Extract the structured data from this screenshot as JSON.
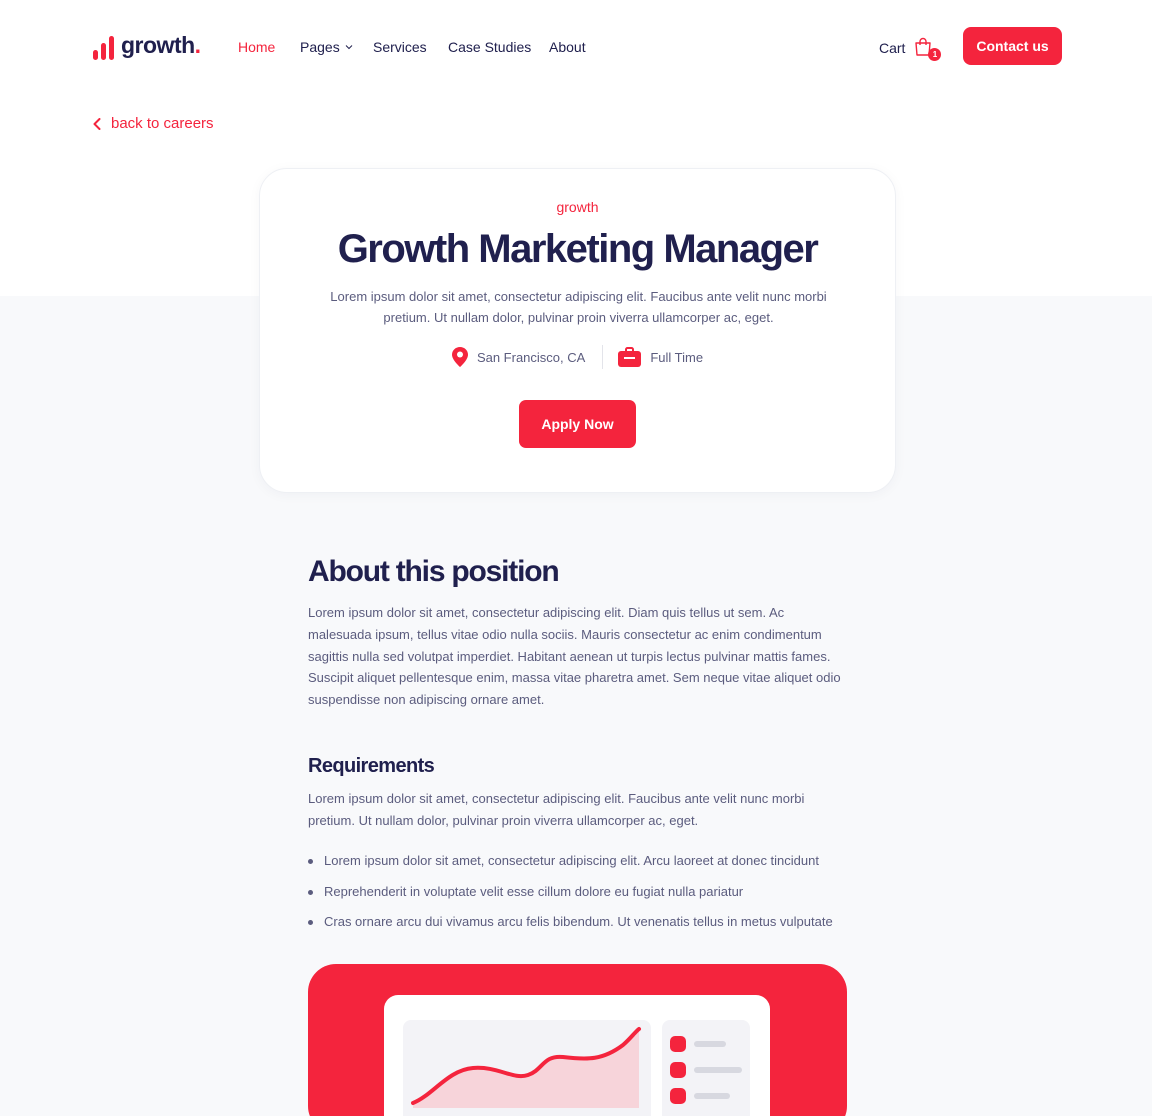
{
  "brand": {
    "name": "growth",
    "dot": ".",
    "accent": "#f4243d",
    "dark": "#20204e"
  },
  "nav": {
    "items": [
      {
        "label": "Home",
        "active": true
      },
      {
        "label": "Pages",
        "dropdown": true
      },
      {
        "label": "Services"
      },
      {
        "label": "Case Studies"
      },
      {
        "label": "About"
      }
    ]
  },
  "cart": {
    "label": "Cart",
    "count": "1",
    "icon": "shopping-bag-icon"
  },
  "contact_button": "Contact us",
  "back_link": {
    "label": "back to careers",
    "icon": "chevron-left-icon"
  },
  "job": {
    "category": "growth",
    "title": "Growth Marketing Manager",
    "description": "Lorem ipsum dolor sit amet, consectetur adipiscing elit. Faucibus ante velit nunc morbi pretium. Ut nullam dolor, pulvinar proin viverra ullamcorper ac, eget.",
    "location": {
      "label": "San Francisco, CA",
      "icon": "location-pin-icon"
    },
    "type": {
      "label": "Full Time",
      "icon": "briefcase-icon"
    },
    "apply_button": "Apply Now"
  },
  "about": {
    "title": "About this position",
    "body": "Lorem ipsum dolor sit amet, consectetur adipiscing elit. Diam quis tellus ut sem. Ac malesuada ipsum, tellus vitae odio nulla sociis. Mauris consectetur ac enim condimentum sagittis nulla sed volutpat imperdiet. Habitant aenean ut turpis lectus pulvinar mattis fames. Suscipit aliquet pellentesque enim, massa vitae pharetra amet. Sem neque vitae aliquet odio suspendisse non adipiscing ornare amet."
  },
  "requirements": {
    "title": "Requirements",
    "body": "Lorem ipsum dolor sit amet, consectetur adipiscing elit. Faucibus ante velit nunc morbi pretium. Ut nullam dolor, pulvinar proin viverra ullamcorper ac, eget.",
    "items": [
      "Lorem ipsum dolor sit amet, consectetur adipiscing elit. Arcu laoreet at donec tincidunt",
      "Reprehenderit in voluptate velit esse cillum dolore eu fugiat nulla pariatur",
      "Cras ornare arcu dui vivamus arcu felis bibendum. Ut venenatis tellus in metus vulputate"
    ]
  }
}
